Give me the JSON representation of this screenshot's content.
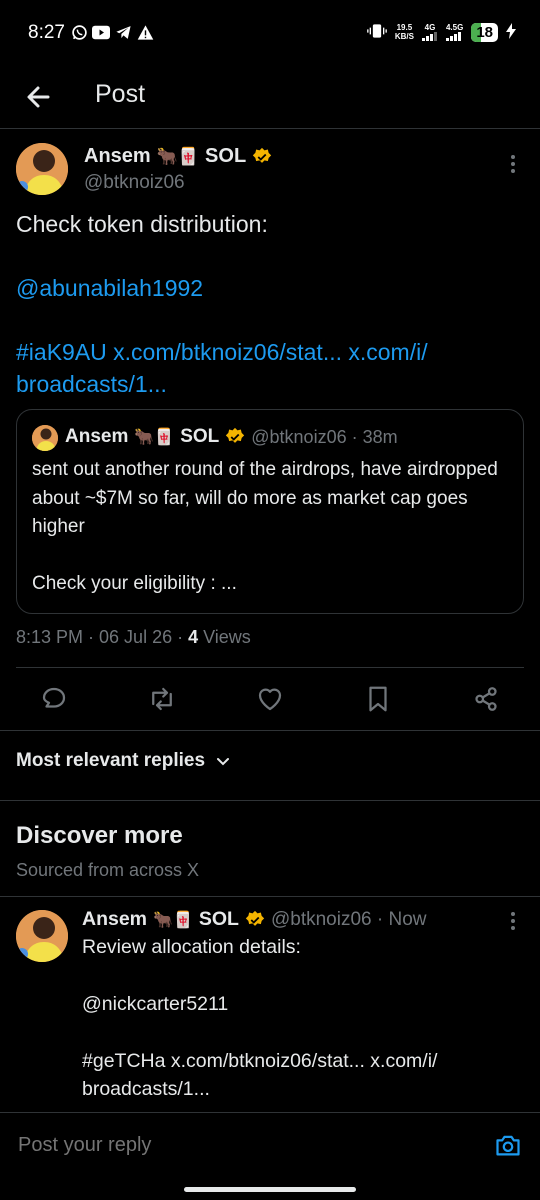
{
  "status_bar": {
    "time": "8:27",
    "net_speed_value": "19.5",
    "net_speed_unit": "KB/S",
    "sim1": "4G",
    "sim2": "4.5G",
    "battery": "18"
  },
  "header": {
    "title": "Post"
  },
  "post": {
    "author": "Ansem",
    "emojis": "🐂🀄",
    "suffix": "SOL",
    "handle": "@btknoiz06",
    "text": "Check token distribution:",
    "mention": "@abunabilah1992",
    "links_line1": "#iaK9AU x.com/btknoiz06/stat... x.com/i/",
    "links_line2": "broadcasts/1...",
    "quote": {
      "author": "Ansem",
      "emojis": "🐂🀄",
      "suffix": "SOL",
      "handle_time": "@btknoiz06 · 38m",
      "text": "sent out another round of the airdrops, have airdropped about ~$7M so far, will do more as market cap goes higher\n\nCheck your eligibility : ..."
    },
    "time_date": "8:13 PM · 06 Jul 26 · ",
    "views_count": "4",
    "views_label": " Views"
  },
  "replies_sort": "Most relevant replies",
  "discover": {
    "title": "Discover more",
    "subtitle": "Sourced from across X"
  },
  "post2": {
    "author": "Ansem",
    "emojis": "🐂🀄",
    "suffix": "SOL",
    "handle_time": "@btknoiz06 · Now",
    "text": "Review allocation details:",
    "mention": "@nickcarter5211",
    "links_line1": "#geTCHa x.com/btknoiz06/stat... x.com/i/",
    "links_line2": "broadcasts/1..."
  },
  "reply_bar": {
    "placeholder": "Post your reply"
  },
  "colors": {
    "accent": "#1d9bf0",
    "verified": "#f4b400",
    "muted": "#71767b"
  }
}
